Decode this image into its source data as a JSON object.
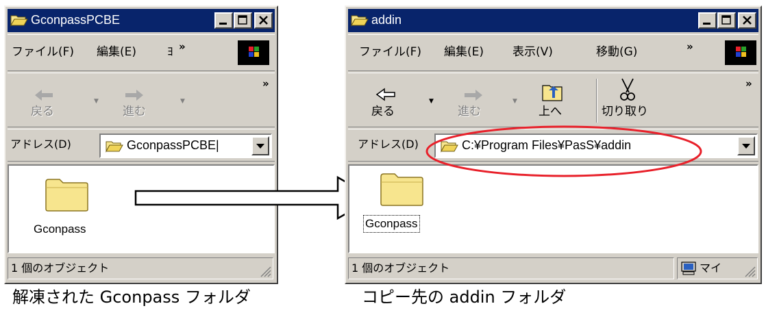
{
  "left_window": {
    "title": "GconpassPCBE",
    "menu": [
      "ファイル(F)",
      "編集(E)",
      "ﾖ"
    ],
    "toolbar": {
      "back": "戻る",
      "forward": "進む"
    },
    "address_label": "アドレス(D)",
    "address_value": "GconpassPCBE|",
    "item_label": "Gconpass",
    "status": "1 個のオブジェクト"
  },
  "right_window": {
    "title": "addin",
    "menu": [
      "ファイル(F)",
      "編集(E)",
      "表示(V)",
      "移動(G)"
    ],
    "toolbar": {
      "back": "戻る",
      "forward": "進む",
      "up": "上へ",
      "cut": "切り取り"
    },
    "address_label": "アドレス(D)",
    "address_value": "C:¥Program Files¥PasS¥addin",
    "item_label": "Gconpass",
    "status": "1 個のオブジェクト",
    "status_right": "マイ"
  },
  "chevron": "»",
  "captions": {
    "left": "解凍された Gconpass フォルダ",
    "right": "コピー先の addin フォルダ"
  },
  "colors": {
    "titlebar": "#08246b",
    "window_face": "#d4d0c8",
    "highlight_ellipse": "#e8202a",
    "folder": "#f7e58e"
  }
}
